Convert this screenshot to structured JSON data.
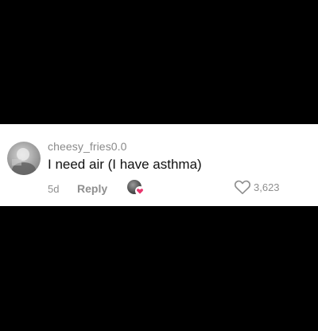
{
  "comment": {
    "username": "cheesy_fries0.0",
    "text": "I need air (I have asthma)",
    "time_ago": "5d",
    "reply_label": "Reply",
    "like_count": "3,623",
    "creator_liked": true
  },
  "icons": {
    "avatar": "user-avatar",
    "creator_badge": "creator-avatar-heart-badge",
    "like": "heart-outline-icon"
  },
  "colors": {
    "background": "#000000",
    "card": "#ffffff",
    "username": "#8a8a8a",
    "text": "#111111",
    "meta": "#8f8f8f",
    "heart_badge": "#e8366d"
  }
}
